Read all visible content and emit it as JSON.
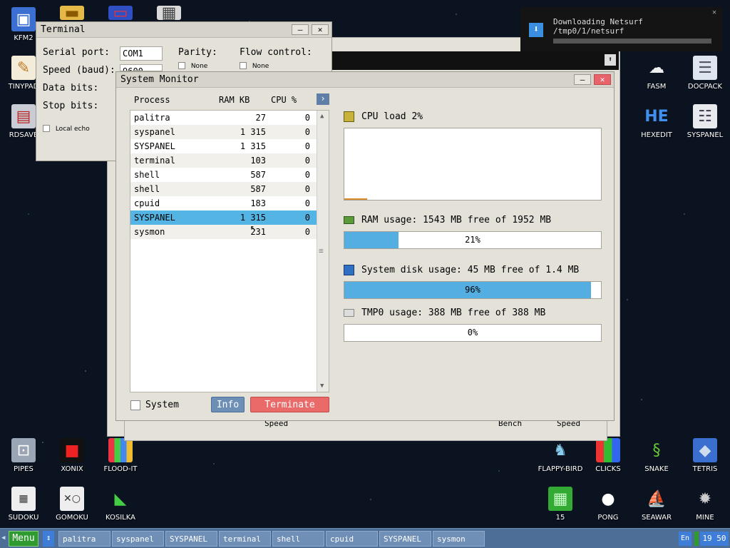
{
  "desktop_icons_left": [
    {
      "label": "KFM2",
      "icon": "floppy-disk-icon"
    },
    {
      "label": "TINYPAD",
      "icon": "notepad-icon"
    },
    {
      "label": "RDSAVE",
      "icon": "disk-save-icon"
    }
  ],
  "desktop_icons_top": [
    {
      "label": "",
      "icon": "folder-icon"
    },
    {
      "label": "",
      "icon": "monitor-icon"
    },
    {
      "label": "",
      "icon": "calculator-icon"
    }
  ],
  "desktop_icons_right": [
    {
      "label": "FASM",
      "icon": "fasm-icon"
    },
    {
      "label": "DOCPACK",
      "icon": "docpack-icon"
    },
    {
      "label": "HEXEDIT",
      "icon": "hexedit-icon"
    },
    {
      "label": "SYSPANEL",
      "icon": "syspanel-icon"
    }
  ],
  "desktop_icons_bottom_left": [
    {
      "label": "PIPES",
      "icon": "pipes-icon"
    },
    {
      "label": "XONIX",
      "icon": "xonix-icon"
    },
    {
      "label": "FLOOD-IT",
      "icon": "flood-it-icon"
    },
    {
      "label": "SUDOKU",
      "icon": "sudoku-icon"
    },
    {
      "label": "GOMOKU",
      "icon": "gomoku-icon"
    },
    {
      "label": "KOSILKA",
      "icon": "lawnmower-icon"
    }
  ],
  "desktop_icons_bottom_right": [
    {
      "label": "FLAPPY-BIRD",
      "icon": "bird-icon"
    },
    {
      "label": "CLICKS",
      "icon": "clicks-icon"
    },
    {
      "label": "SNAKE",
      "icon": "snake-icon"
    },
    {
      "label": "TETRIS",
      "icon": "tetris-icon"
    },
    {
      "label": "15",
      "icon": "fifteen-icon"
    },
    {
      "label": "PONG",
      "icon": "pong-icon"
    },
    {
      "label": "SEAWAR",
      "icon": "ship-icon"
    },
    {
      "label": "MINE",
      "icon": "mine-icon"
    }
  ],
  "terminal": {
    "title": "Terminal",
    "serial_port_label": "Serial port:",
    "serial_port_value": "COM1",
    "speed_label": "Speed (baud):",
    "speed_value": "9600",
    "data_bits_label": "Data bits:",
    "stop_bits_label": "Stop bits:",
    "local_echo_label": "Local echo",
    "parity_label": "Parity:",
    "parity_value": "None",
    "flow_label": "Flow control:",
    "flow_value": "None",
    "minimize": "—",
    "close": "✕"
  },
  "background_window": {
    "speed_label_1": "Speed",
    "bench_label": "Bench",
    "speed_label_2": "Speed"
  },
  "sysmon": {
    "title": "System Monitor",
    "minimize": "—",
    "close": "✕",
    "columns": {
      "process": "Process",
      "ram": "RAM KB",
      "cpu": "CPU %"
    },
    "expand_btn": "›",
    "processes": [
      {
        "name": "palitra",
        "ram": "27",
        "cpu": "0"
      },
      {
        "name": "syspanel",
        "ram": "1 315",
        "cpu": "0"
      },
      {
        "name": "SYSPANEL",
        "ram": "1 315",
        "cpu": "0"
      },
      {
        "name": "terminal",
        "ram": "103",
        "cpu": "0"
      },
      {
        "name": "shell",
        "ram": "587",
        "cpu": "0"
      },
      {
        "name": "shell",
        "ram": "587",
        "cpu": "0"
      },
      {
        "name": "cpuid",
        "ram": "183",
        "cpu": "0"
      },
      {
        "name": "SYSPANEL",
        "ram": "1 315",
        "cpu": "0"
      },
      {
        "name": "sysmon",
        "ram": "231",
        "cpu": "0"
      }
    ],
    "selected_index": 7,
    "system_label": "System",
    "info_btn": "Info",
    "terminate_btn": "Terminate",
    "cpu_label": "CPU load 2%",
    "cpu_percent": 2,
    "ram_label": "RAM usage: 1543 MB free of 1952 MB",
    "ram_pct": "21%",
    "ram_fill": 21,
    "disk_label": "System disk usage: 45 MB free of 1.4 MB",
    "disk_pct": "96%",
    "disk_fill": 96,
    "tmp_label": "TMP0 usage: 388 MB free of 388 MB",
    "tmp_pct": "0%",
    "tmp_fill": 0
  },
  "notification": {
    "title": "Downloading Netsurf",
    "path": "/tmp0/1/netsurf",
    "progress": 0
  },
  "taskbar": {
    "menu": "Menu",
    "switch": "↕",
    "items": [
      "palitra",
      "syspanel",
      "SYSPANEL",
      "terminal",
      "shell",
      "cpuid",
      "SYSPANEL",
      "sysmon"
    ],
    "lang": "En",
    "clock": "19 50"
  },
  "colors": {
    "accent": "#54b4e3",
    "terminate": "#ea6a6a",
    "taskbar": "#4c6e97"
  }
}
